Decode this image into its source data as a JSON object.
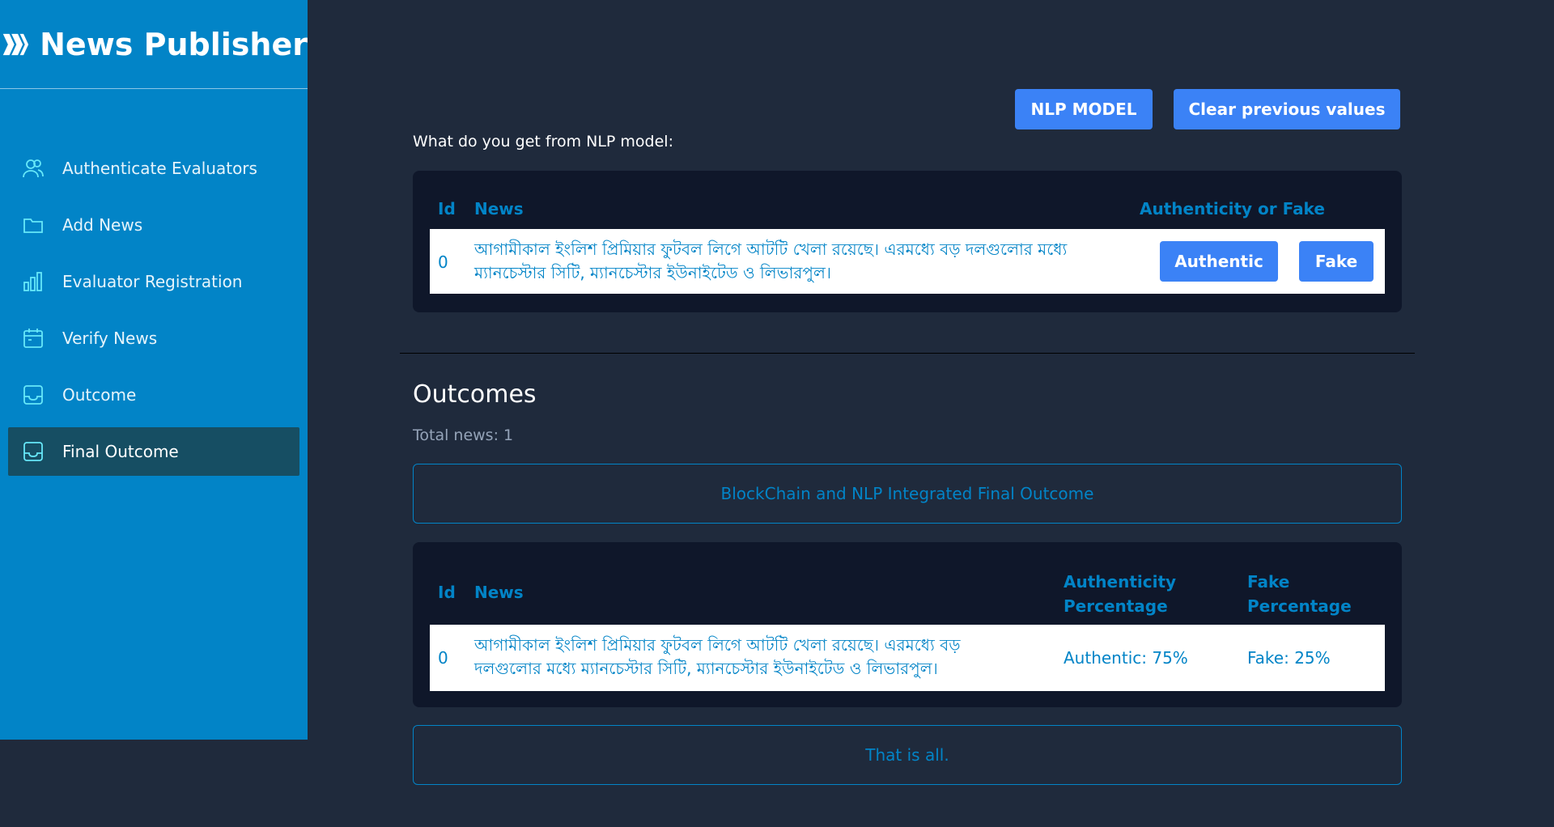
{
  "sidebar": {
    "brand": "News Publisher",
    "items": [
      {
        "label": "Authenticate Evaluators",
        "icon": "users-icon"
      },
      {
        "label": "Add News",
        "icon": "folder-icon"
      },
      {
        "label": "Evaluator Registration",
        "icon": "bar-chart-icon"
      },
      {
        "label": "Verify News",
        "icon": "calendar-icon"
      },
      {
        "label": "Outcome",
        "icon": "inbox-icon"
      },
      {
        "label": "Final Outcome",
        "icon": "inbox-icon",
        "active": true
      }
    ]
  },
  "toolbar": {
    "nlp_label": "NLP MODEL",
    "clear_label": "Clear previous values"
  },
  "nlp_section": {
    "prompt": "What do you get from NLP model:",
    "headers": {
      "id": "Id",
      "news": "News",
      "auth": "Authenticity or Fake"
    },
    "rows": [
      {
        "id": "0",
        "news_line1": "আগামীকাল ইংলিশ প্রিমিয়ার ফুটবল লিগে আটটি খেলা রয়েছে। এরমধ্যে বড় দলগুলোর মধ্যে",
        "news_line2": "ম্যানচেস্টার সিটি, ম্যানচেস্টার ইউনাইটেড ও লিভারপুল।",
        "authentic_label": "Authentic",
        "fake_label": "Fake"
      }
    ]
  },
  "outcomes": {
    "title": "Outcomes",
    "total": "Total news: 1",
    "banner": "BlockChain and NLP Integrated Final Outcome",
    "headers": {
      "id": "Id",
      "news": "News",
      "auth_line1": "Authenticity",
      "auth_line2": "Percentage",
      "fake_line1": "Fake",
      "fake_line2": "Percentage"
    },
    "rows": [
      {
        "id": "0",
        "news_line1": "আগামীকাল ইংলিশ প্রিমিয়ার ফুটবল লিগে আটটি খেলা রয়েছে। এরমধ্যে বড়",
        "news_line2": "দলগুলোর মধ্যে ম্যানচেস্টার সিটি, ম্যানচেস্টার ইউনাইটেড ও লিভারপুল।",
        "authentic": "Authentic: 75%",
        "fake": "Fake: 25%"
      }
    ],
    "footer": "That is all."
  },
  "colors": {
    "sidebar": "#0284c7",
    "background": "#1f2a3c",
    "card": "#0f172a",
    "button": "#3b82f6",
    "accent_text": "#0284c7",
    "active_nav": "#164e63"
  }
}
